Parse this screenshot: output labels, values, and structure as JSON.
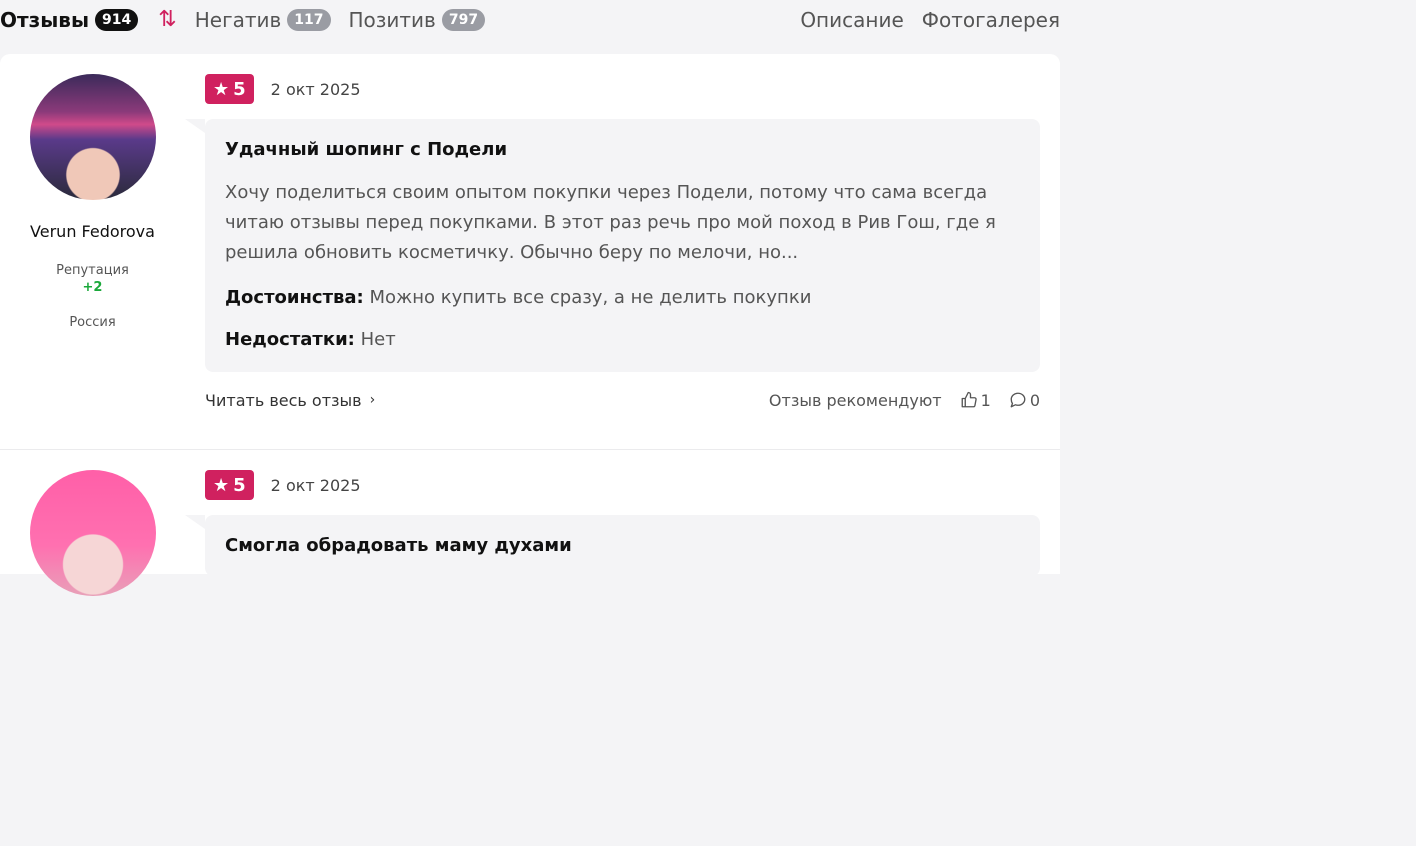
{
  "tabs": {
    "reviews": {
      "label": "Отзывы",
      "count": "914"
    },
    "negative": {
      "label": "Негатив",
      "count": "117"
    },
    "positive": {
      "label": "Позитив",
      "count": "797"
    }
  },
  "nav": {
    "description": "Описание",
    "gallery": "Фотогалерея"
  },
  "colors": {
    "accent": "#d0215f",
    "reputation": "#1aa83a"
  },
  "reviews": [
    {
      "author": "Verun Fedorova",
      "reputation_label": "Репутация",
      "reputation": "+2",
      "country": "Россия",
      "rating": "5",
      "date": "2 окт 2025",
      "title": "Удачный шопинг с Подели",
      "text": "Хочу поделиться своим опытом покупки через Подели, потому что сама всегда читаю отзывы перед покупками. В этот раз речь про мой поход в Рив Гош, где я решила обновить косметичку. Обычно беру по мелочи, но...",
      "pros_label": "Достоинства:",
      "pros": "Можно купить все сразу, а не делить покупки",
      "cons_label": "Недостатки:",
      "cons": "Нет",
      "read_more": "Читать весь отзыв",
      "recommend": "Отзыв рекомендуют",
      "likes": "1",
      "comments": "0"
    },
    {
      "rating": "5",
      "date": "2 окт 2025",
      "title": "Смогла обрадовать маму духами"
    }
  ]
}
